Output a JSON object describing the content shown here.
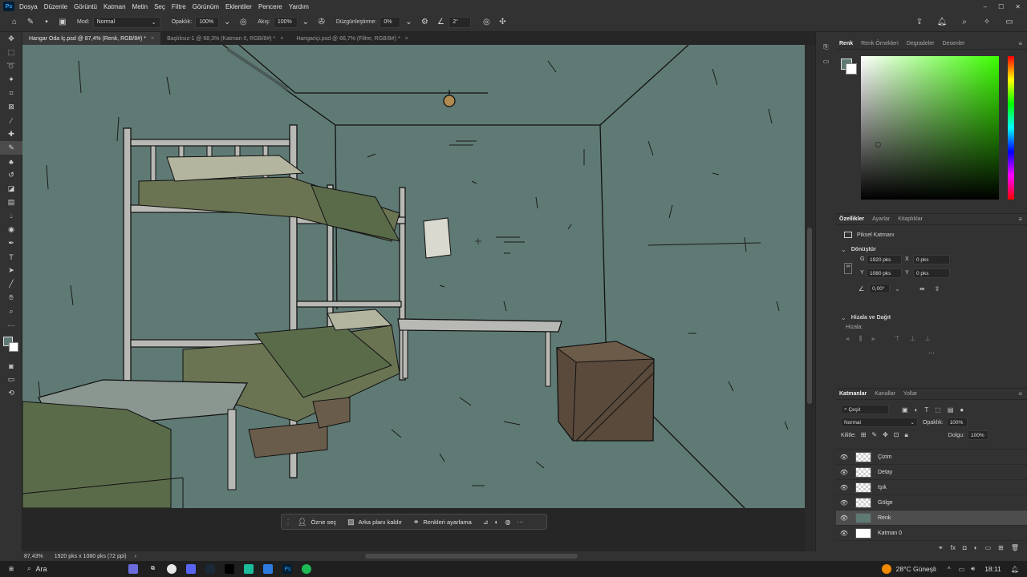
{
  "menu": [
    "Dosya",
    "Düzenle",
    "Görüntü",
    "Katman",
    "Metin",
    "Seç",
    "Filtre",
    "Görünüm",
    "Eklentiler",
    "Pencere",
    "Yardım"
  ],
  "options": {
    "mode_label": "Mod:",
    "mode_value": "Normal",
    "opacity_label": "Opaklık:",
    "opacity_value": "100%",
    "flow_label": "Akış:",
    "flow_value": "100%",
    "smoothing_label": "Düzgünleştirme:",
    "smoothing_value": "0%",
    "angle_value": "2°"
  },
  "tabs": [
    {
      "label": "Hangar Oda İç.psd @ 87,4% (Renk, RGB/8#) *"
    },
    {
      "label": "Başlıksız-1 @ 68,3% (Katman 0, RGB/8#) *"
    },
    {
      "label": "Hangariçi.psd @ 66,7% (Filtre, RGB/8#) *"
    }
  ],
  "context_bar": {
    "select_subject": "Özne seç",
    "remove_bg": "Arka planı kaldır",
    "adjust_colors": "Renkleri ayarlama"
  },
  "status": {
    "zoom": "87,43%",
    "doc_size": "1920 pks x 1080 pks (72 ppi)"
  },
  "color_panel": {
    "tabs": [
      "Renk",
      "Renk Örnekleri",
      "Degradeler",
      "Desenler"
    ]
  },
  "properties_panel": {
    "tabs": [
      "Özellikler",
      "Ayarlar",
      "Kitaplıklar"
    ],
    "kind": "Piksel Katmanı",
    "transform_title": "Dönüştür",
    "w_label": "G",
    "w_value": "1920 pks",
    "h_label": "Y",
    "h_value": "1080 pks",
    "x_label": "X",
    "x_value": "0 pks",
    "y_label": "Y",
    "y_value": "0 pks",
    "angle_value": "0,00°",
    "align_title": "Hizala ve Dağıt",
    "align_label": "Hizala:"
  },
  "layers_panel": {
    "tabs": [
      "Katmanlar",
      "Kanallar",
      "Yollar"
    ],
    "filter_value": "Çeşit",
    "blend_value": "Normal",
    "opacity_label": "Opaklık:",
    "opacity_value": "100%",
    "lock_label": "Kilitle:",
    "fill_label": "Dolgu:",
    "fill_value": "100%",
    "layers": [
      {
        "name": "Çizim"
      },
      {
        "name": "Detay"
      },
      {
        "name": "Işık"
      },
      {
        "name": "Gölge"
      },
      {
        "name": "Renk"
      },
      {
        "name": "Katman 0"
      }
    ]
  },
  "taskbar": {
    "search": "Ara",
    "weather": "28°C Güneşli",
    "time": "18:11"
  },
  "colors": {
    "canvas_bg": "#5f7a74",
    "accent_blue": "#31a8ff",
    "blanket_green": "#5a6b4a",
    "crate_brown": "#5a4a3c"
  }
}
